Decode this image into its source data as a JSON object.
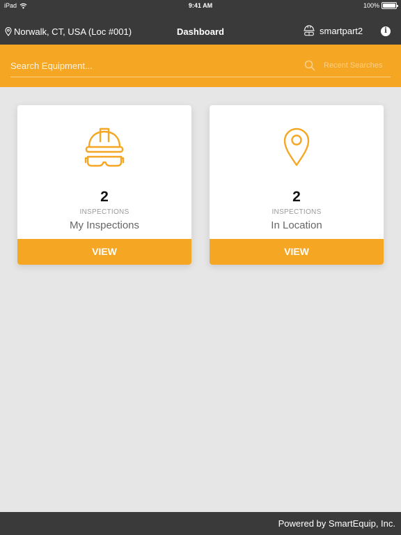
{
  "status_bar": {
    "device": "iPad",
    "time": "9:41 AM",
    "battery": "100%",
    "battery_level": 1.0
  },
  "nav": {
    "location": "Norwalk, CT, USA (Loc #001)",
    "title": "Dashboard",
    "username": "smartpart2",
    "info_label": "i"
  },
  "search": {
    "placeholder": "Search Equipment...",
    "value": "",
    "recent_label": "Recent Searches"
  },
  "cards": [
    {
      "count": "2",
      "subtitle": "INSPECTIONS",
      "title": "My Inspections",
      "button_label": "VIEW",
      "icon": "hard-hat-goggles-icon"
    },
    {
      "count": "2",
      "subtitle": "INSPECTIONS",
      "title": "In Location",
      "button_label": "VIEW",
      "icon": "location-pin-icon"
    }
  ],
  "footer": {
    "text": "Powered by SmartEquip, Inc."
  },
  "colors": {
    "accent": "#f5a623",
    "dark": "#3a3a3a",
    "background": "#e6e6e6"
  }
}
